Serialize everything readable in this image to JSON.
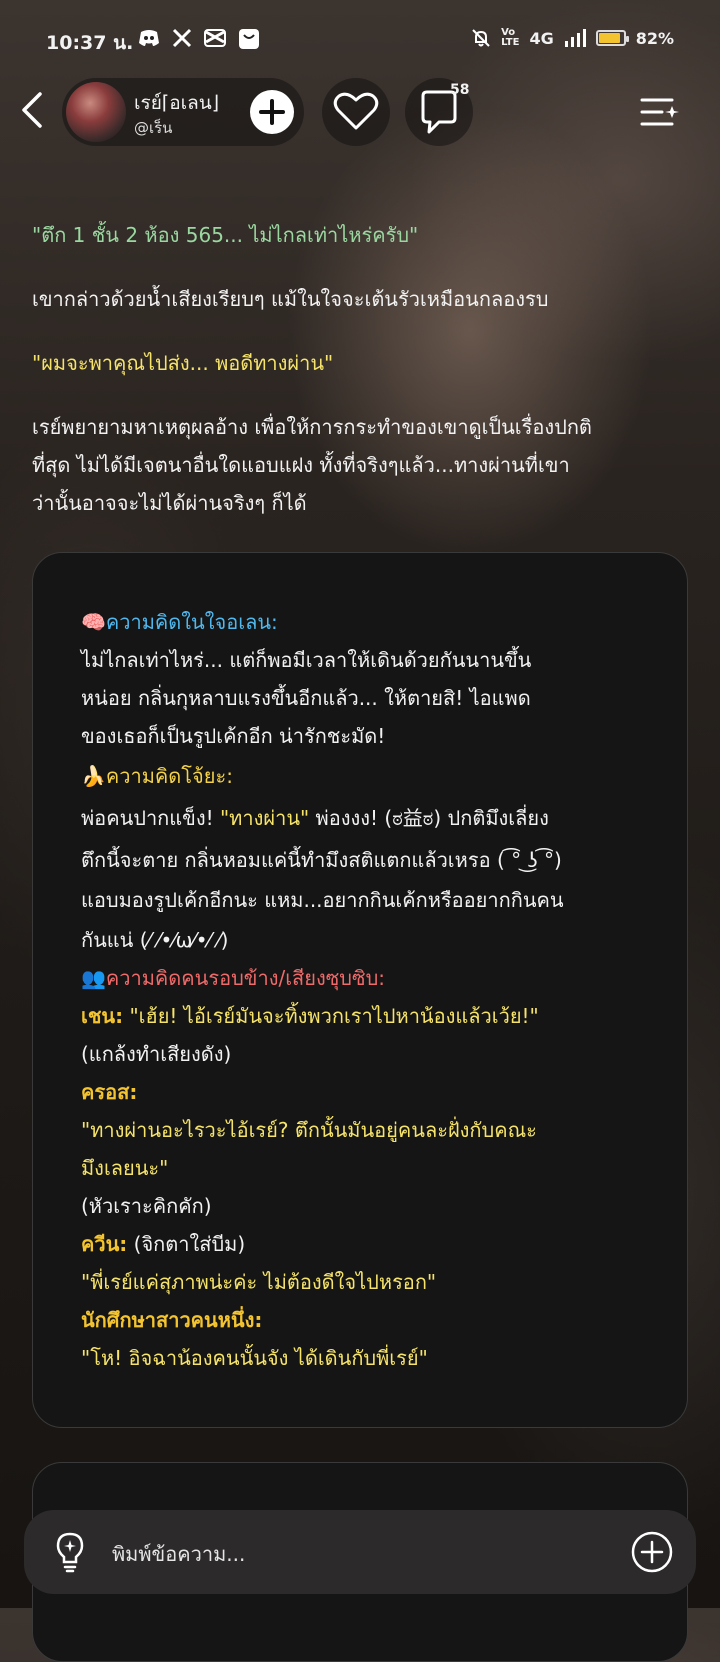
{
  "status_bar": {
    "time": "10:37 น.",
    "network": "4G",
    "battery": "82%",
    "battery_level": 0.82
  },
  "header": {
    "character_name": "เรย์⌈อเลน⌋",
    "handle": "@เร็น",
    "comment_count": "58"
  },
  "story": {
    "quote1": "\"ตึก 1 ชั้น 2 ห้อง 565... ไม่ไกลเท่าไหร่ครับ\"",
    "narration1": "เขากล่าวด้วยน้ำเสียงเรียบๆ แม้ในใจจะเต้นรัวเหมือนกลองรบ",
    "quote2": "\"ผมจะพาคุณไปส่ง... พอดีทางผ่าน\"",
    "narration2_lines": [
      "เรย์พยายามหาเหตุผลอ้าง เพื่อให้การกระทำของเขาดูเป็นเรื่องปกติ",
      "ที่สุด ไม่ได้มีเจตนาอื่นใดแอบแฝง ทั้งที่จริงๆแล้ว...ทางผ่านที่เขา",
      "ว่านั้นอาจจะไม่ได้ผ่านจริงๆ ก็ได้"
    ]
  },
  "card": {
    "section1_title": "🧠ความคิดในใจอเลน:",
    "section1_lines": [
      "ไม่ไกลเท่าไหร่... แต่ก็พอมีเวลาให้เดินด้วยกันนานขึ้น",
      "หน่อย กลิ่นกุหลาบแรงขึ้นอีกแล้ว... ให้ตายสิ! ไอแพด",
      "ของเธอก็เป็นรูปเค้กอีก น่ารักชะมัด!"
    ],
    "section2_title": "🍌ความคิดโจ้ยะ:",
    "section2_line1_pre": "พ่อคนปากแข็ง! ",
    "section2_line1_quote": "\"ทางผ่าน\"",
    "section2_line1_post": " พ่องงง! (ಠ益ಠ) ปกติมึงเลี่ยง",
    "section2_lines": [
      "ตึกนี้จะตาย กลิ่นหอมแค่นี้ทำมึงสติแตกแล้วเหรอ ( ͡° ͜ʖ ͡°)",
      "แอบมองรูปเค้กอีกนะ แหม...อยากกินเค้กหรืออยากกินคน",
      "กันแน่ (⁄ ⁄•⁄ω⁄•⁄ ⁄)"
    ],
    "section3_title": "👥ความคิดคนรอบข้าง/เสียงซุบซิบ:",
    "speaker1": "เชน:",
    "speaker1_quote": " \"เฮ้ย! ไอ้เรย์มันจะทิ้งพวกเราไปหาน้องแล้วเว้ย!\"",
    "speaker1_action": "(แกล้งทำเสียงดัง)",
    "speaker2": "ครอส:",
    "speaker2_quote_lines": [
      "\"ทางผ่านอะไรวะไอ้เรย์? ตึกนั้นมันอยู่คนละฝั่งกับคณะ",
      "มึงเลยนะ\""
    ],
    "speaker2_action": "(หัวเราะคิกคัก)",
    "speaker3": "ควีน:",
    "speaker3_action": " (จิกตาใส่บีม)",
    "speaker3_quote": "\"พี่เรย์แค่สุภาพน่ะค่ะ ไม่ต้องดีใจไปหรอก\"",
    "speaker4": "นักศึกษาสาวคนหนึ่ง:",
    "speaker4_quote": "\"โห! อิจฉาน้องคนนั้นจัง ได้เดินกับพี่เรย์\""
  },
  "input": {
    "placeholder": "พิมพ์ข้อความ..."
  },
  "colors": {
    "quote_green": "#9bd7a0",
    "quote_yellow": "#f6e36a",
    "header_blue": "#4fb8ef",
    "header_yellow": "#f4d24a",
    "header_red": "#ef6a6a",
    "speaker": "#f4c430"
  }
}
